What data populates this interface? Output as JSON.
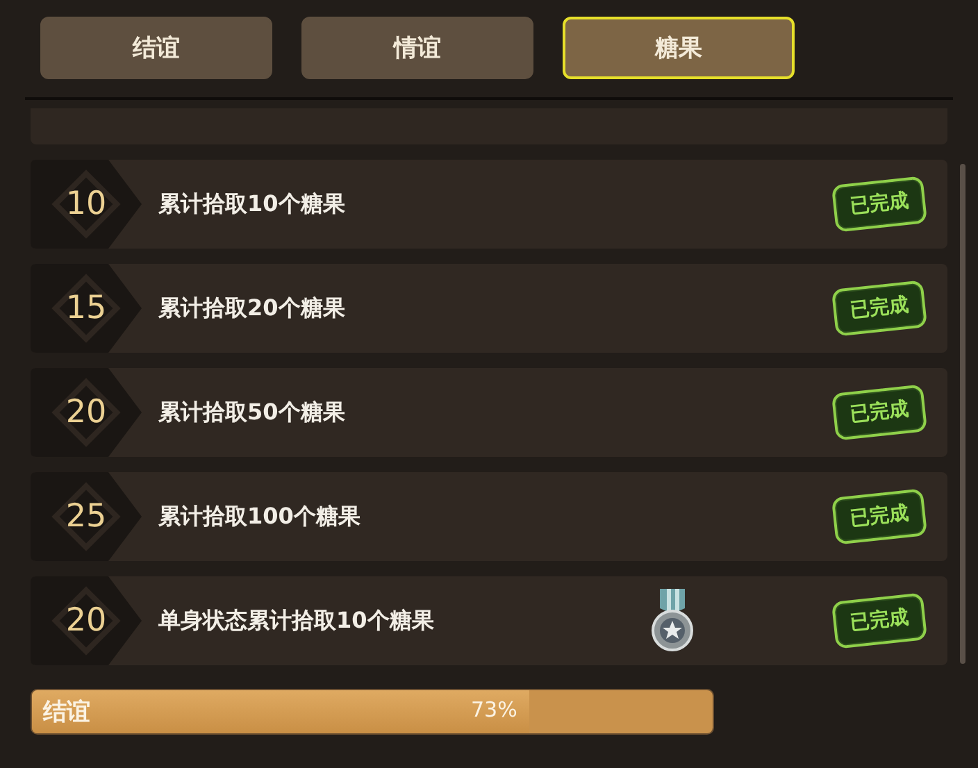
{
  "tabs": [
    {
      "label": "结谊",
      "selected": false
    },
    {
      "label": "情谊",
      "selected": false
    },
    {
      "label": "糖果",
      "selected": true
    }
  ],
  "tasks": [
    {
      "points": "10",
      "text": "累计拾取10个糖果",
      "medal": false,
      "status": "已完成"
    },
    {
      "points": "15",
      "text": "累计拾取20个糖果",
      "medal": false,
      "status": "已完成"
    },
    {
      "points": "20",
      "text": "累计拾取50个糖果",
      "medal": false,
      "status": "已完成"
    },
    {
      "points": "25",
      "text": "累计拾取100个糖果",
      "medal": false,
      "status": "已完成"
    },
    {
      "points": "20",
      "text": "单身状态累计拾取10个糖果",
      "medal": true,
      "status": "已完成"
    }
  ],
  "progress": {
    "label": "结谊",
    "level": 0.73,
    "reading": "73%"
  }
}
